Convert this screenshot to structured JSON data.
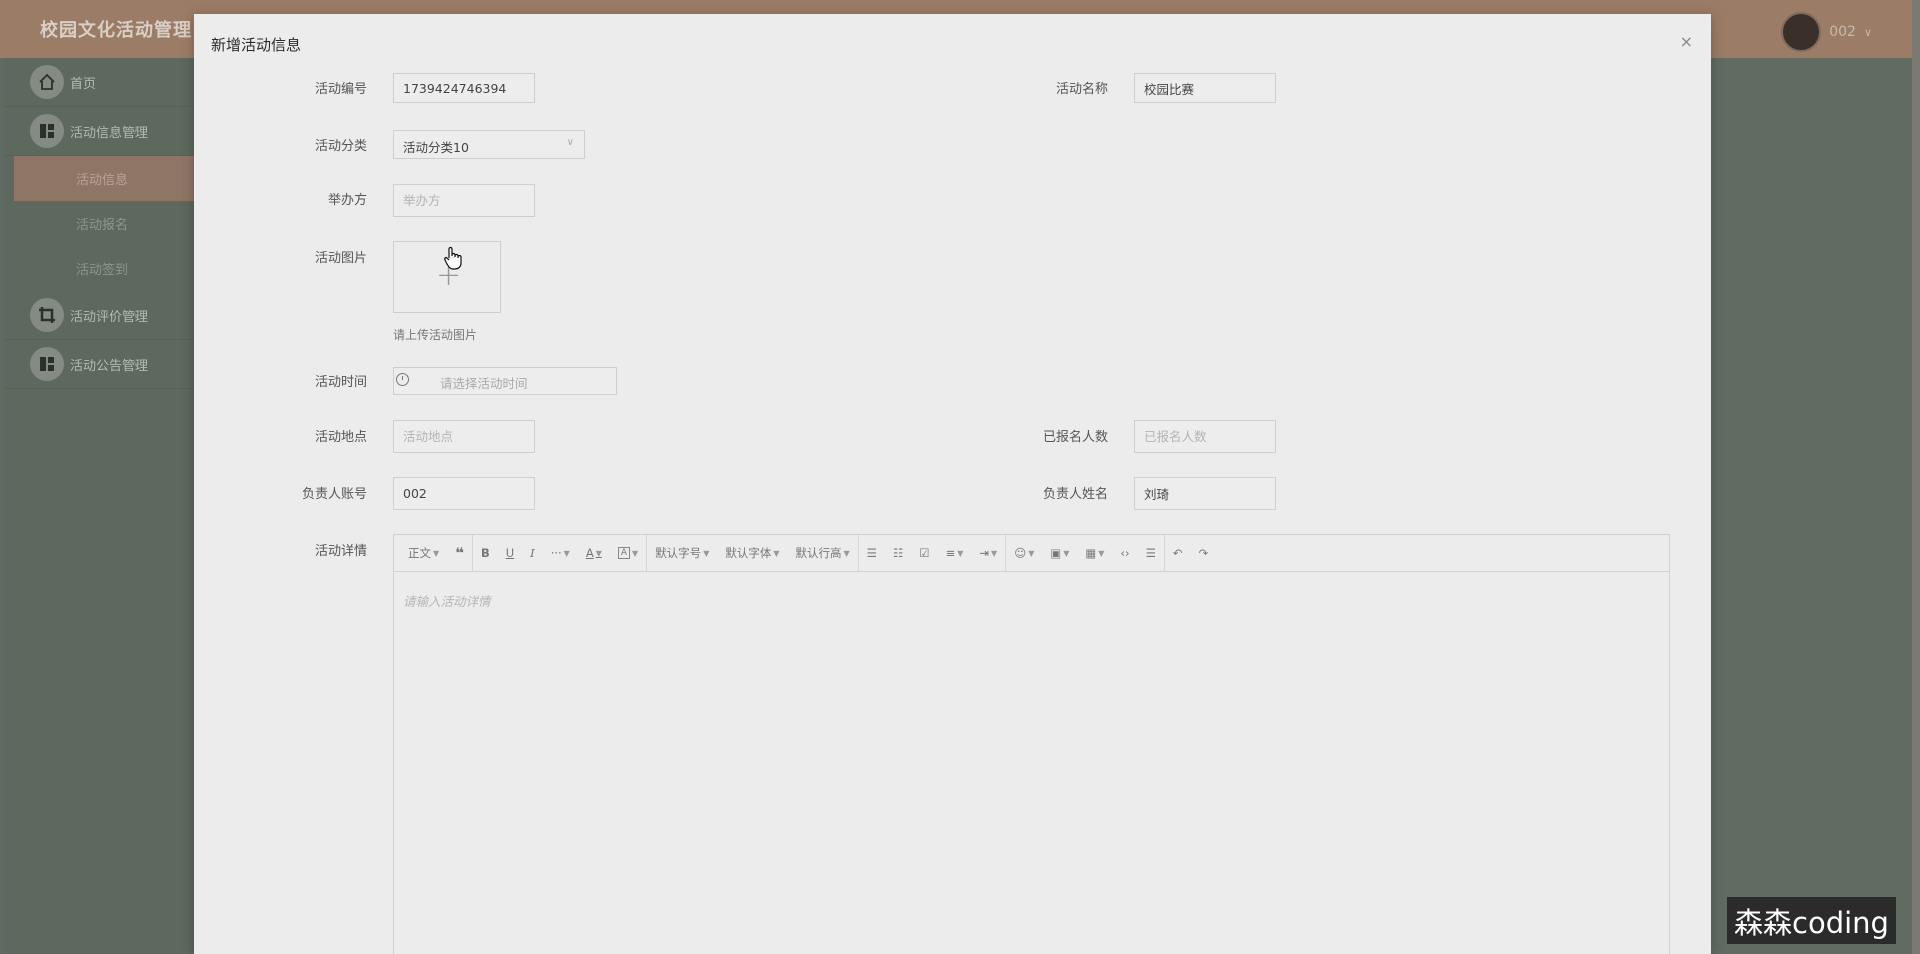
{
  "app": {
    "title": "校园文化活动管理",
    "user_name": "002"
  },
  "sidebar": {
    "items": [
      {
        "label": "首页"
      },
      {
        "label": "活动信息管理"
      },
      {
        "label": "活动评价管理"
      },
      {
        "label": "活动公告管理"
      }
    ],
    "sub_items": [
      {
        "label": "活动信息"
      },
      {
        "label": "活动报名"
      },
      {
        "label": "活动签到"
      }
    ]
  },
  "dialog": {
    "title": "新增活动信息",
    "close_icon": "×",
    "fields": {
      "activity_no": {
        "label": "活动编号",
        "value": "1739424746394"
      },
      "activity_name": {
        "label": "活动名称",
        "value": "校园比赛"
      },
      "category": {
        "label": "活动分类",
        "value": "活动分类10"
      },
      "organizer": {
        "label": "举办方",
        "placeholder": "举办方"
      },
      "image": {
        "label": "活动图片",
        "hint": "请上传活动图片"
      },
      "time": {
        "label": "活动时间",
        "placeholder": "请选择活动时间"
      },
      "location": {
        "label": "活动地点",
        "placeholder": "活动地点"
      },
      "signed_count": {
        "label": "已报名人数",
        "placeholder": "已报名人数"
      },
      "owner_account": {
        "label": "负责人账号",
        "value": "002"
      },
      "owner_name": {
        "label": "负责人姓名",
        "value": "刘琦"
      },
      "detail": {
        "label": "活动详情",
        "placeholder": "请输入活动详情"
      }
    },
    "editor_toolbar": {
      "paragraph": "正文",
      "font_size": "默认字号",
      "font_family": "默认字体",
      "line_height": "默认行高"
    }
  },
  "watermark": "森森coding"
}
